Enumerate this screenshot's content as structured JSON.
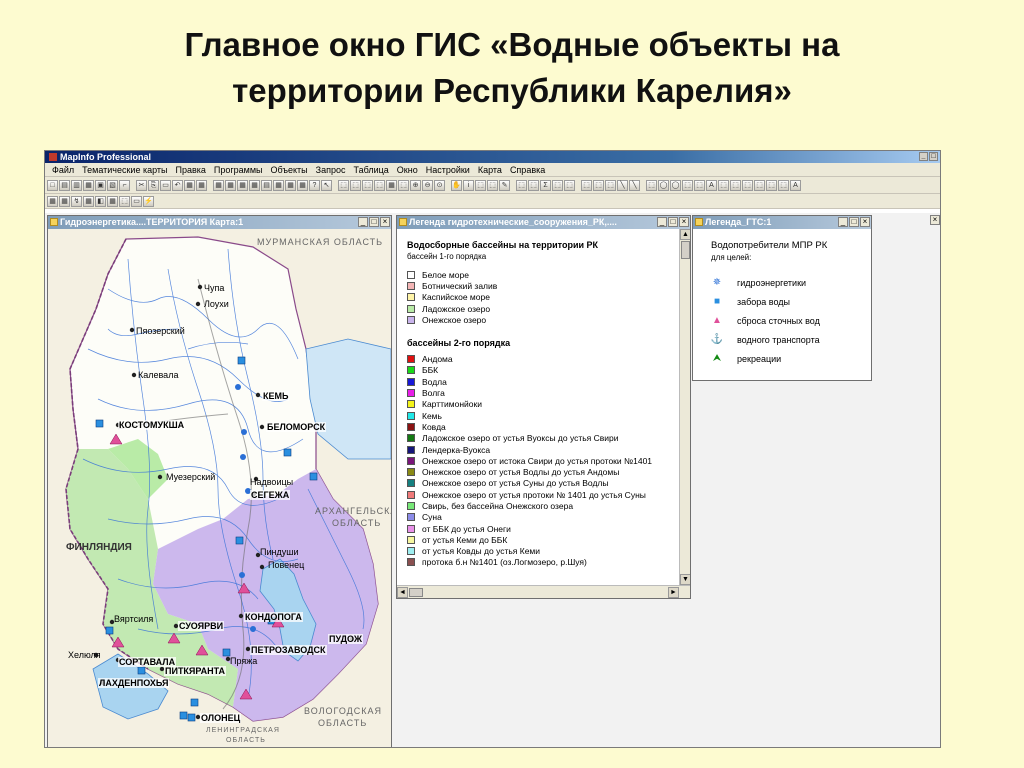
{
  "slide": {
    "title_line1": "Главное окно ГИС «Водные объекты на",
    "title_line2": "территории Республики Карелия»"
  },
  "app": {
    "title": "MapInfo Professional",
    "menu": [
      "Файл",
      "Тематические карты",
      "Правка",
      "Программы",
      "Объекты",
      "Запрос",
      "Таблица",
      "Окно",
      "Настройки",
      "Карта",
      "Справка"
    ]
  },
  "map_window": {
    "title": "Гидроэнергетика....ТЕРРИТОРИЯ Карта:1",
    "labels": {
      "murmansk": "МУРМАНСКАЯ ОБЛАСТЬ",
      "arkhangelsk1": "АРХАНГЕЛЬСКАЯ",
      "arkhangelsk2": "ОБЛАСТЬ",
      "finland": "ФИНЛЯНДИЯ",
      "vologda1": "ВОЛОГОДСКАЯ",
      "vologda2": "ОБЛАСТЬ",
      "leningrad1": "ЛЕНИНГРАДСКАЯ",
      "leningrad2": "ОБЛАСТЬ",
      "chupa": "Чупа",
      "loukhi": "Лоухи",
      "pyaozersky": "Пяозерский",
      "kalevala": "Калевала",
      "kem": "КЕМЬ",
      "kostomuksha": "КОСТОМУКША",
      "belomorsk": "БЕЛОМОРСК",
      "muezersky": "Муезерский",
      "nadvoitsy": "Надвоицы",
      "segezha": "СЕГЕЖА",
      "pindushi": "Пиндуши",
      "povenets": "Повенец",
      "vyartsilya": "Вяртсиля",
      "suoyarvi": "СУОЯРВИ",
      "kondopoga": "КОНДОПОГА",
      "pudozh": "ПУДОЖ",
      "helyulya": "Хелюля",
      "sortavala": "СОРТАВАЛА",
      "pitkyaranta": "ПИТКЯРАНТА",
      "petrozavodsk": "ПЕТРОЗАВОДСК",
      "pryazha": "Пряжа",
      "lakhdenpokhya": "ЛАХДЕНПОХЬЯ",
      "olonets": "ОЛОНЕЦ"
    }
  },
  "legend1": {
    "title": "Легенда гидротехнические_сооружения_РК,....",
    "heading": "Водосборные бассейны на территории РК",
    "subheading": "бассейн 1-го порядка",
    "order1": [
      {
        "label": "Белое море",
        "color": "#ffffff"
      },
      {
        "label": "Ботнический залив",
        "color": "#f4b6b6"
      },
      {
        "label": "Каспийское море",
        "color": "#fff4a8"
      },
      {
        "label": "Ладожское озеро",
        "color": "#b9eba7"
      },
      {
        "label": "Онежское озеро",
        "color": "#c9b4ec"
      }
    ],
    "heading2": "бассейны 2-го порядка",
    "order2": [
      {
        "label": "Андома",
        "color": "#e01010"
      },
      {
        "label": "ББК",
        "color": "#19d919"
      },
      {
        "label": "Водла",
        "color": "#1818d8"
      },
      {
        "label": "Волга",
        "color": "#e81ee8"
      },
      {
        "label": "Карттимонйоки",
        "color": "#f4f41a"
      },
      {
        "label": "Кемь",
        "color": "#20e8e8"
      },
      {
        "label": "Ковда",
        "color": "#8a1212"
      },
      {
        "label": "Ладожское озеро от устья Вуоксы до устья Свири",
        "color": "#137a13"
      },
      {
        "label": "Лендерка-Вуокса",
        "color": "#15157a"
      },
      {
        "label": "Онежское озеро от истока Свири до устья протоки №1401",
        "color": "#7a157a"
      },
      {
        "label": "Онежское озеро от устья Водлы до устья Андомы",
        "color": "#8a8a14"
      },
      {
        "label": "Онежское озеро от устья Суны до устья Водлы",
        "color": "#158080"
      },
      {
        "label": "Онежское озеро от устья протоки № 1401 до устья Суны",
        "color": "#f07a7a"
      },
      {
        "label": "Свирь, без бассейна Онежского озера",
        "color": "#78e878"
      },
      {
        "label": "Суна",
        "color": "#8c8ce8"
      },
      {
        "label": "от ББК до устья Онеги",
        "color": "#e890e8"
      },
      {
        "label": "от устья Кеми до ББК",
        "color": "#f6f6a0"
      },
      {
        "label": "от устья Ковды до устья Кеми",
        "color": "#9eeef0"
      },
      {
        "label": "протока б.н №1401 (оз.Логмозеро, р.Шуя)",
        "color": "#8a5050"
      }
    ]
  },
  "legend2": {
    "title": "Легенда_ГТС:1",
    "heading": "Водопотребители МПР РК",
    "subheading": "для целей:",
    "items": [
      {
        "label": "гидроэнергетики",
        "icon": "gear-icon",
        "glyph": "✵",
        "color": "#2a6fd6"
      },
      {
        "label": "забора воды",
        "icon": "square-icon",
        "glyph": "■",
        "color": "#2a8fe0"
      },
      {
        "label": "сброса сточных вод",
        "icon": "triangle-icon",
        "glyph": "▲",
        "color": "#e0509a"
      },
      {
        "label": "водного транспорта",
        "icon": "anchor-icon",
        "glyph": "⚓",
        "color": "#2a4fbf"
      },
      {
        "label": "рекреации",
        "icon": "arrow-up-icon",
        "glyph": "⮝",
        "color": "#138a13"
      }
    ]
  }
}
